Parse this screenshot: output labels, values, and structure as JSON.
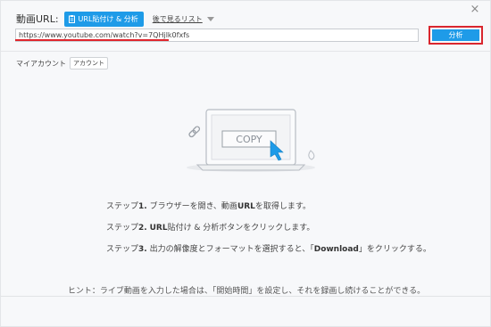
{
  "header": {
    "close_glyph": "×",
    "url_label": "動画URL:",
    "paste_button_label": "URL貼付け & 分析",
    "later_list_label": "後で見るリスト"
  },
  "url_input": {
    "value": "https://www.youtube.com/watch?v=7QHjlk0fxfs"
  },
  "analyze_button_label": "分析",
  "account": {
    "label": "マイアカウント",
    "button_label": "アカウント"
  },
  "illustration": {
    "copy_text": "COPY"
  },
  "steps": [
    {
      "prefix": "ステップ",
      "number": "1.",
      "text_before": " ブラウザーを開き、動画",
      "bold": "URL",
      "text_after": "を取得します。"
    },
    {
      "prefix": "ステップ",
      "number": "2.",
      "text_before": " ",
      "bold": "URL",
      "text_after": "貼付け & 分析ボタンをクリックします。"
    },
    {
      "prefix": "ステップ",
      "number": "3.",
      "text_before": " 出力の解像度とフォーマットを選択すると、「",
      "bold": "Download",
      "text_after": "」をクリックする。"
    }
  ],
  "hint": "ヒント：ライブ動画を入力した場合は、「開始時間」を設定し、それを録画し続けることができる。",
  "colors": {
    "accent": "#1e9be8",
    "highlight_red": "#d9262e"
  }
}
